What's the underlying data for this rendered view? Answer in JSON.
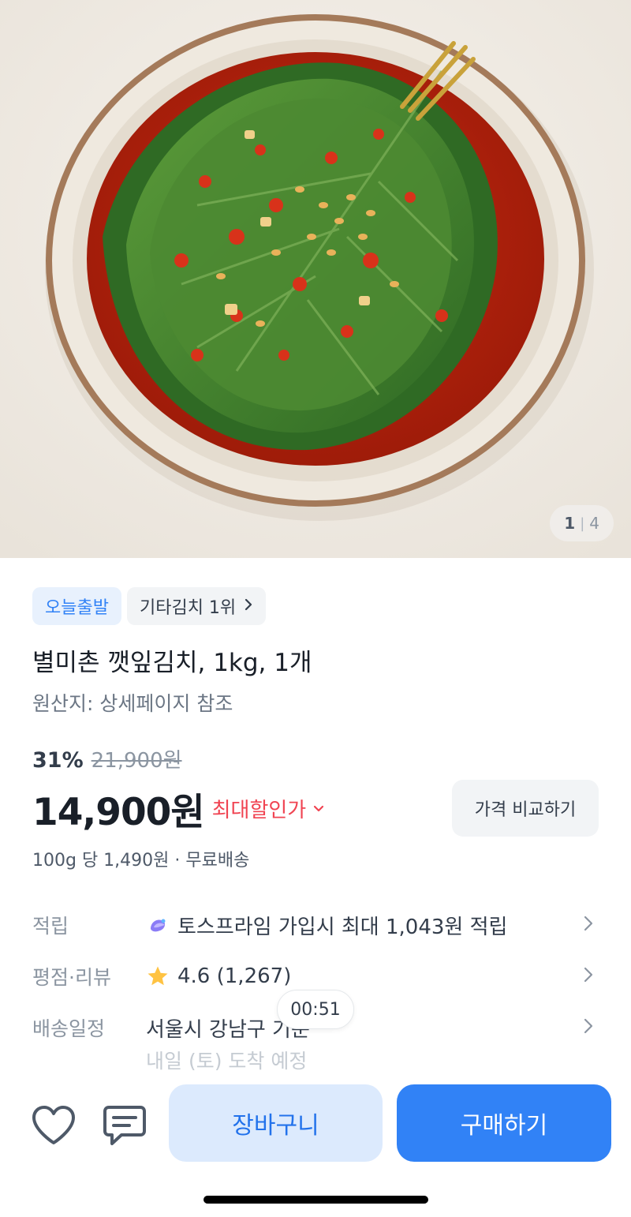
{
  "gallery": {
    "current": "1",
    "separator": "|",
    "total": "4",
    "image_description": "Perilla leaf kimchi in a ceramic bowl"
  },
  "badges": [
    {
      "label": "오늘출발"
    },
    {
      "label": "기타김치 1위"
    }
  ],
  "product": {
    "title": "별미촌 깻잎김치, 1kg, 1개",
    "origin": "원산지: 상세페이지 참조"
  },
  "pricing": {
    "discount_rate": "31%",
    "original_price": "21,900원",
    "price": "14,900원",
    "max_discount_label": "최대할인가",
    "compare_label": "가격 비교하기",
    "unit_shipping": "100g 당 1,490원 · 무료배송"
  },
  "info": {
    "points_label": "적립",
    "points_value": "토스프라임 가입시 최대 1,043원 적립",
    "rating_label": "평점·리뷰",
    "rating_value": "4.6 (1,267)",
    "delivery_label": "배송일정",
    "delivery_value": "서울시 강남구 기준",
    "delivery_sub": "내일 (토) 도착 예정"
  },
  "timer": "00:51",
  "actions": {
    "cart_label": "장바구니",
    "buy_label": "구매하기"
  },
  "colors": {
    "primary": "#3182f6",
    "discount_red": "#f04452",
    "star": "#ffc342"
  }
}
